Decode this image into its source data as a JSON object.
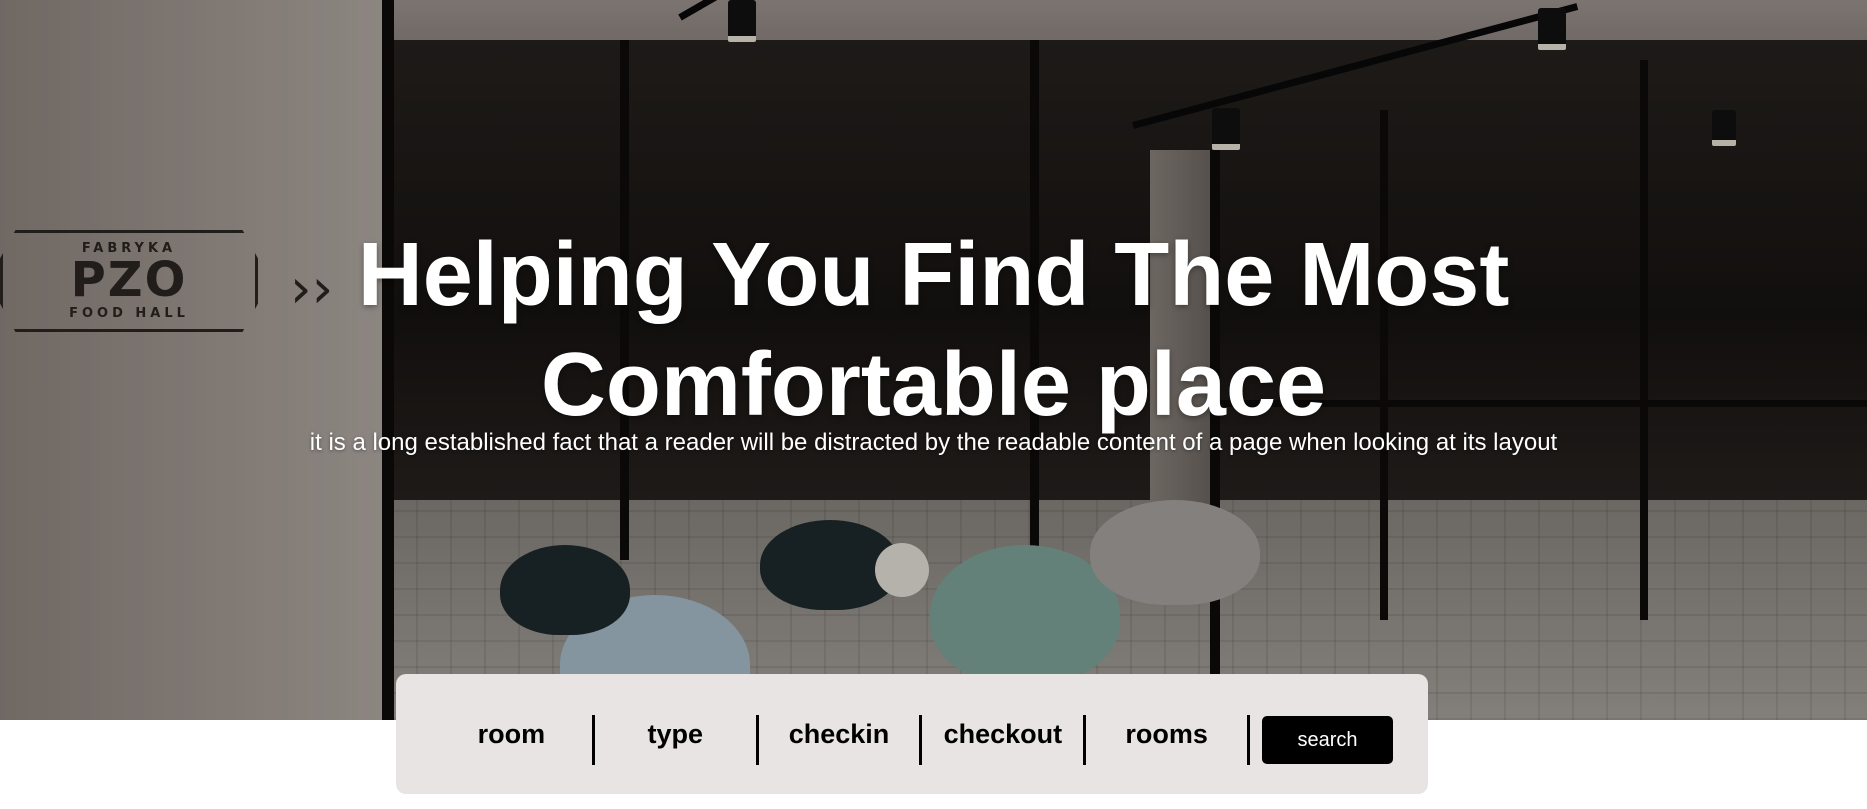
{
  "hero": {
    "title_line1": "Helping You Find The Most",
    "title_line2": "Comfortable place",
    "subtitle": "it is a long established fact that a reader will be distracted by the readable content of a page when looking at its layout",
    "background_logo": {
      "top": "FABRYKA",
      "main": "PZO",
      "bottom": "FOOD HALL"
    }
  },
  "search": {
    "fields": [
      "room",
      "type",
      "checkin",
      "checkout",
      "rooms"
    ],
    "button_label": "search"
  },
  "colors": {
    "search_bar_bg": "#e9e4e4",
    "button_bg": "#000000",
    "text_light": "#ffffff"
  }
}
